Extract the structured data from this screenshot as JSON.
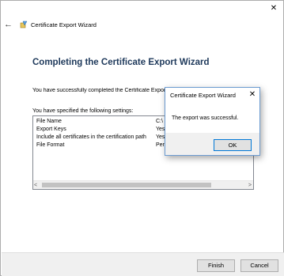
{
  "window": {
    "title": "Certificate Export Wizard",
    "close_glyph": "✕",
    "back_glyph": "←"
  },
  "main": {
    "heading": "Completing the Certificate Export Wizard",
    "success_text": "You have successfully completed the Certificate Export Wizard.",
    "specified_text": "You have specified the following settings:",
    "settings": [
      {
        "key": "File Name",
        "value": "C:\\"
      },
      {
        "key": "Export Keys",
        "value": "Yes"
      },
      {
        "key": "Include all certificates in the certification path",
        "value": "Yes"
      },
      {
        "key": "File Format",
        "value": "Pers"
      }
    ],
    "scroll_left": "<",
    "scroll_right": ">"
  },
  "footer": {
    "finish_label": "Finish",
    "cancel_label": "Cancel"
  },
  "dialog": {
    "title": "Certificate Export Wizard",
    "close_glyph": "✕",
    "message": "The export was successful.",
    "ok_label": "OK"
  },
  "colors": {
    "heading": "#1e395b",
    "accent": "#0078d7"
  }
}
